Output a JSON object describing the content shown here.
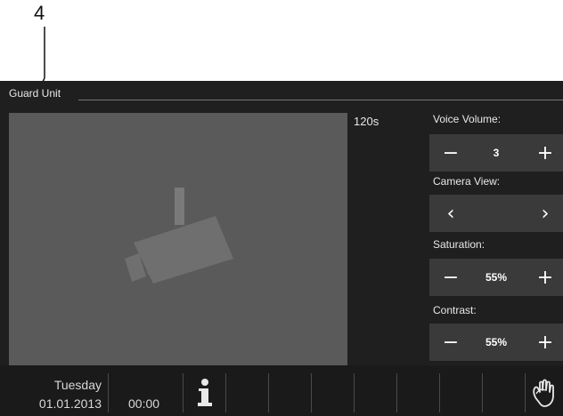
{
  "callout": {
    "number": "4"
  },
  "titlebar": {
    "title": "Guard Unit"
  },
  "video": {
    "timer": "120s",
    "camera_icon": "security-camera-icon"
  },
  "controls": {
    "voice_volume": {
      "label": "Voice Volume:",
      "value": "3",
      "minus": "−",
      "plus": "+"
    },
    "camera_view": {
      "label": "Camera View:",
      "prev": "‹",
      "next": "›"
    },
    "saturation": {
      "label": "Saturation:",
      "value": "55%",
      "minus": "−",
      "plus": "+"
    },
    "contrast": {
      "label": "Contrast:",
      "value": "55%",
      "minus": "−",
      "plus": "+"
    }
  },
  "bottom": {
    "day": "Tuesday",
    "date": "01.01.2013",
    "time": "00:00",
    "info_icon": "info-icon",
    "hand_icon": "hand-icon"
  },
  "colors": {
    "screen_bg": "#1f1f1f",
    "video_bg": "#5a5a5a",
    "control_bg": "#3a3a3a",
    "text": "#e8e8e8"
  }
}
